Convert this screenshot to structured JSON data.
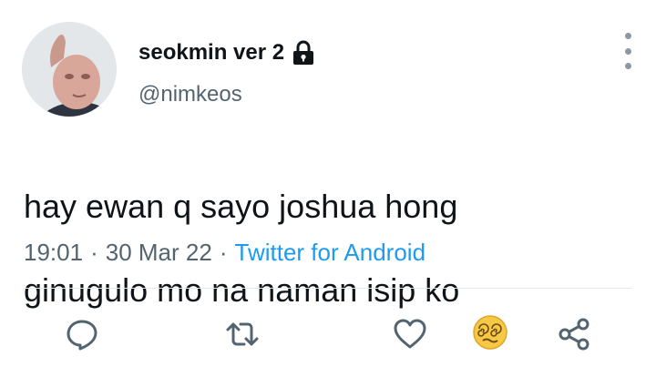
{
  "tweet": {
    "display_name": "seokmin ver 2",
    "handle": "@nimkeos",
    "text_line1": "hay ewan q sayo joshua hong",
    "text_line2": "ginugulo mo na naman isip ko",
    "emoji": "dizzy-face-emoji",
    "time": "19:01",
    "date": "30 Mar 22",
    "separator": "·",
    "source": "Twitter for Android",
    "locked": true
  },
  "icons": {
    "more": "vertical-ellipsis-icon",
    "lock": "lock-icon",
    "reply": "reply-icon",
    "retweet": "retweet-icon",
    "like": "heart-icon",
    "share": "share-icon"
  },
  "colors": {
    "text": "#0f1419",
    "secondary": "#536471",
    "link": "#1d9bf0",
    "divider": "#e7e9ea"
  }
}
